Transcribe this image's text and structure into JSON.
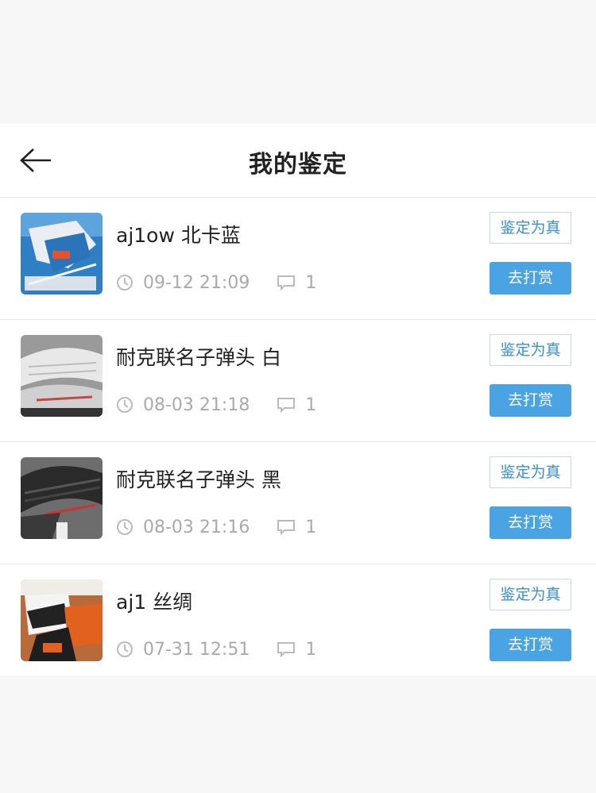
{
  "header": {
    "title": "我的鉴定"
  },
  "items": [
    {
      "name": "aj1ow 北卡蓝",
      "time": "09-12 21:09",
      "comments": "1",
      "badge": "鉴定为真",
      "button": "去打赏"
    },
    {
      "name": "耐克联名子弹头 白",
      "time": "08-03 21:18",
      "comments": "1",
      "badge": "鉴定为真",
      "button": "去打赏"
    },
    {
      "name": "耐克联名子弹头 黑",
      "time": "08-03 21:16",
      "comments": "1",
      "badge": "鉴定为真",
      "button": "去打赏"
    },
    {
      "name": "aj1 丝绸",
      "time": "07-31 12:51",
      "comments": "1",
      "badge": "鉴定为真",
      "button": "去打赏"
    }
  ],
  "colors": {
    "accent": "#4aa3e2",
    "badge_text": "#3a8fd8",
    "meta_text": "#aaaaaa"
  },
  "icons": {
    "back": "arrow-left-icon",
    "time": "clock-icon",
    "comments": "comment-icon"
  }
}
